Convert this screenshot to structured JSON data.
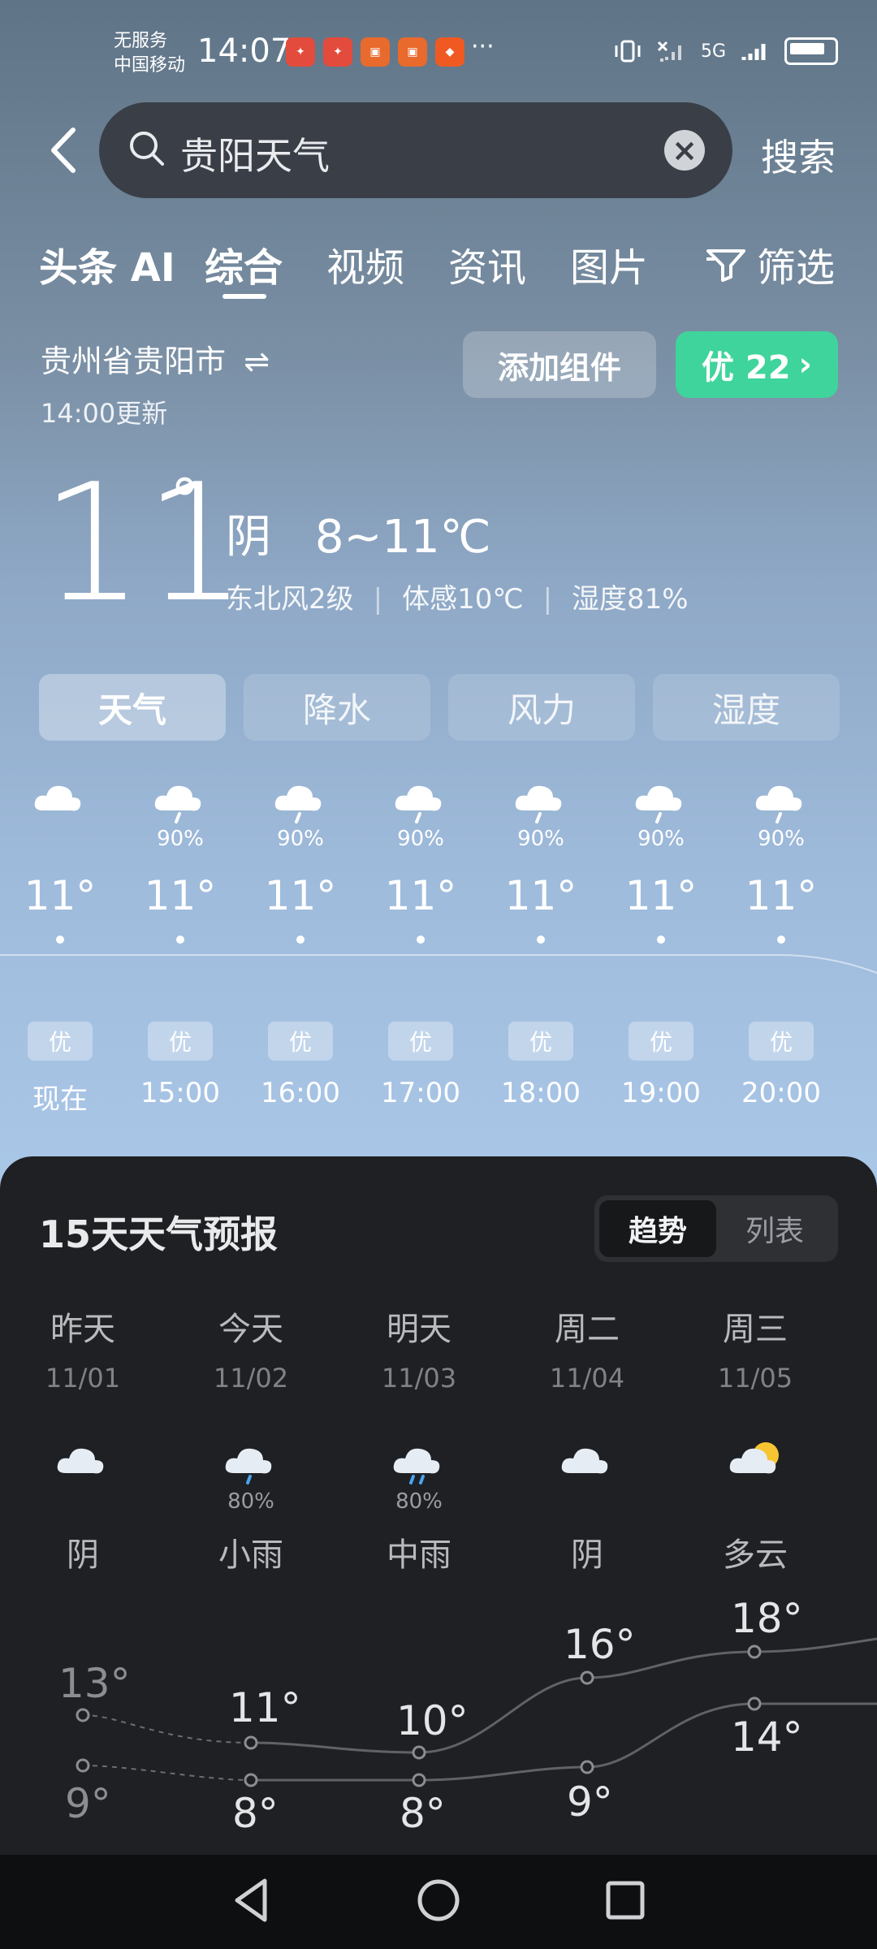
{
  "status_bar": {
    "carrier_line1": "无服务",
    "carrier_line2": "中国移动",
    "time": "14:07",
    "more": "···",
    "network": "5G"
  },
  "search": {
    "query": "贵阳天气",
    "button": "搜索"
  },
  "tabs": [
    "头条 AI",
    "综合",
    "视频",
    "资讯",
    "图片"
  ],
  "filter_label": "筛选",
  "location": {
    "name": "贵州省贵阳市",
    "updated": "14:00更新"
  },
  "actions": {
    "add_widget": "添加组件",
    "aqi_badge": "优 22"
  },
  "current": {
    "temp": "11",
    "condition": "阴",
    "range": "8~11℃",
    "wind": "东北风2级",
    "feels_like": "体感10℃",
    "humidity": "湿度81%"
  },
  "metric_tabs": [
    "天气",
    "降水",
    "风力",
    "湿度"
  ],
  "hourly": [
    {
      "prob": "",
      "temp": "11°",
      "aq": "优",
      "time": "现在",
      "icon": "cloud-icon"
    },
    {
      "prob": "90%",
      "temp": "11°",
      "aq": "优",
      "time": "15:00",
      "icon": "rain-icon"
    },
    {
      "prob": "90%",
      "temp": "11°",
      "aq": "优",
      "time": "16:00",
      "icon": "rain-icon"
    },
    {
      "prob": "90%",
      "temp": "11°",
      "aq": "优",
      "time": "17:00",
      "icon": "rain-icon"
    },
    {
      "prob": "90%",
      "temp": "11°",
      "aq": "优",
      "time": "18:00",
      "icon": "rain-icon"
    },
    {
      "prob": "90%",
      "temp": "11°",
      "aq": "优",
      "time": "19:00",
      "icon": "rain-icon"
    },
    {
      "prob": "90%",
      "temp": "11°",
      "aq": "优",
      "time": "20:00",
      "icon": "rain-icon"
    }
  ],
  "forecast": {
    "title": "15天天气预报",
    "toggle": [
      "趋势",
      "列表"
    ],
    "days": [
      {
        "day": "昨天",
        "date": "11/01",
        "prob": "",
        "cond": "阴",
        "high": "13°",
        "low": "9°",
        "icon": "cloud-icon"
      },
      {
        "day": "今天",
        "date": "11/02",
        "prob": "80%",
        "cond": "小雨",
        "high": "11°",
        "low": "8°",
        "icon": "light-rain-icon"
      },
      {
        "day": "明天",
        "date": "11/03",
        "prob": "80%",
        "cond": "中雨",
        "high": "10°",
        "low": "8°",
        "icon": "moderate-rain-icon"
      },
      {
        "day": "周二",
        "date": "11/04",
        "prob": "",
        "cond": "阴",
        "high": "16°",
        "low": "9°",
        "icon": "cloud-icon"
      },
      {
        "day": "周三",
        "date": "11/05",
        "prob": "",
        "cond": "多云",
        "high": "18°",
        "low": "14°",
        "icon": "partly-cloudy-icon"
      }
    ]
  }
}
